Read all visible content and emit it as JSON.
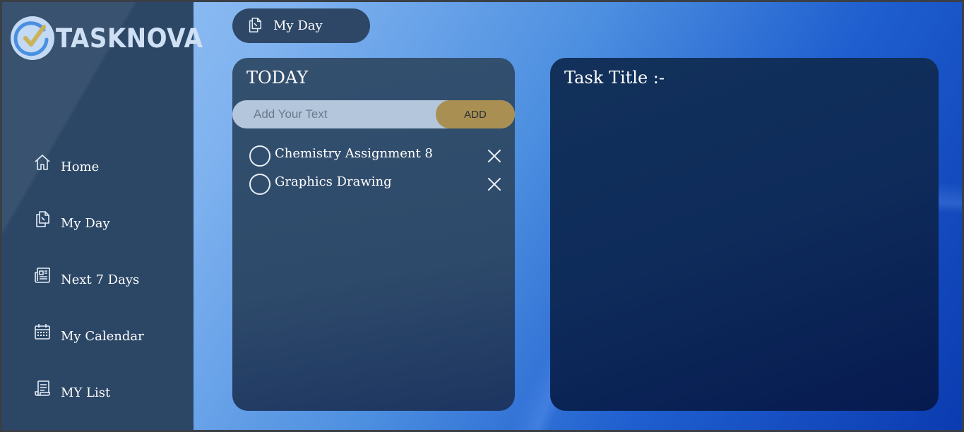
{
  "app": {
    "name": "TASKNOVA"
  },
  "sidebar": {
    "items": [
      {
        "label": "Home",
        "icon": "home-icon"
      },
      {
        "label": "My Day",
        "icon": "copy-files-icon"
      },
      {
        "label": "Next 7 Days",
        "icon": "newspaper-icon"
      },
      {
        "label": "My Calendar",
        "icon": "calendar-icon"
      },
      {
        "label": "MY List",
        "icon": "list-scroll-icon"
      }
    ]
  },
  "header": {
    "current_view": "My Day",
    "icon": "copy-files-icon"
  },
  "today": {
    "title": "TODAY",
    "input_placeholder": "Add Your Text",
    "add_label": "ADD",
    "tasks": [
      {
        "text": "Chemistry Assignment 8",
        "done": false
      },
      {
        "text": "Graphics Drawing",
        "done": false
      }
    ]
  },
  "detail": {
    "title": "Task Title :-"
  },
  "colors": {
    "sidebar": "#2c4766",
    "panel": "#2e4a6a",
    "detail_panel": "#0e2b5a",
    "add_button": "#a99052",
    "input": "#b3c6db",
    "logo_check": "#c9b25a",
    "logo_ring": "#4a8fe0"
  }
}
